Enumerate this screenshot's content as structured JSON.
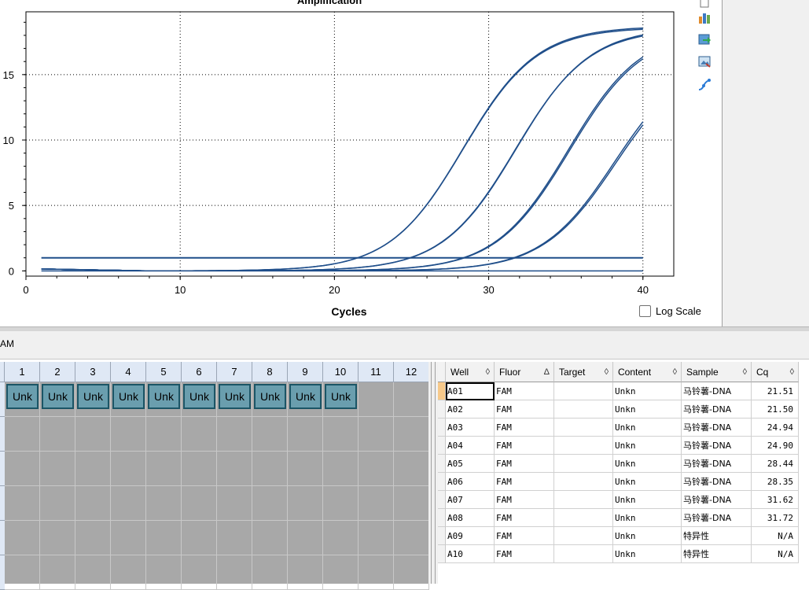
{
  "chart_data": {
    "type": "line",
    "title": "Amplification",
    "xlabel": "Cycles",
    "ylabel": "",
    "xlim": [
      0,
      42
    ],
    "ylim": [
      -0.4,
      19.8
    ],
    "xticks": [
      0,
      10,
      20,
      30,
      40
    ],
    "yticks": [
      0,
      5,
      10,
      15
    ],
    "grid": true,
    "line_color": "#1f4e8a",
    "threshold": 1.0,
    "cycle_range": [
      1,
      40
    ],
    "series": [
      {
        "cq": 21.51,
        "plateau": 18.6
      },
      {
        "cq": 21.5,
        "plateau": 18.7
      },
      {
        "cq": 24.94,
        "plateau": 18.6
      },
      {
        "cq": 24.9,
        "plateau": 18.5
      },
      {
        "cq": 28.44,
        "plateau": 18.4
      },
      {
        "cq": 28.35,
        "plateau": 18.5
      },
      {
        "cq": 31.62,
        "plateau": 16.7
      },
      {
        "cq": 31.72,
        "plateau": 16.5
      }
    ]
  },
  "log_scale_label": "Log Scale",
  "fluor_label": "AM",
  "plate": {
    "columns": [
      "1",
      "2",
      "3",
      "4",
      "5",
      "6",
      "7",
      "8",
      "9",
      "10",
      "11",
      "12"
    ],
    "filled_label": "Unk",
    "filled_count": 10,
    "rows": 6
  },
  "table": {
    "headers": [
      {
        "label": "Well",
        "sort": "◊"
      },
      {
        "label": "Fluor",
        "sort": "Δ"
      },
      {
        "label": "Target",
        "sort": "◊"
      },
      {
        "label": "Content",
        "sort": "◊"
      },
      {
        "label": "Sample",
        "sort": "◊"
      },
      {
        "label": "Cq",
        "sort": "◊"
      }
    ],
    "rows": [
      [
        "A01",
        "FAM",
        "",
        "Unkn",
        "马铃薯-DNA",
        "21.51"
      ],
      [
        "A02",
        "FAM",
        "",
        "Unkn",
        "马铃薯-DNA",
        "21.50"
      ],
      [
        "A03",
        "FAM",
        "",
        "Unkn",
        "马铃薯-DNA",
        "24.94"
      ],
      [
        "A04",
        "FAM",
        "",
        "Unkn",
        "马铃薯-DNA",
        "24.90"
      ],
      [
        "A05",
        "FAM",
        "",
        "Unkn",
        "马铃薯-DNA",
        "28.44"
      ],
      [
        "A06",
        "FAM",
        "",
        "Unkn",
        "马铃薯-DNA",
        "28.35"
      ],
      [
        "A07",
        "FAM",
        "",
        "Unkn",
        "马铃薯-DNA",
        "31.62"
      ],
      [
        "A08",
        "FAM",
        "",
        "Unkn",
        "马铃薯-DNA",
        "31.72"
      ],
      [
        "A09",
        "FAM",
        "",
        "Unkn",
        "特异性",
        "N/A"
      ],
      [
        "A10",
        "FAM",
        "",
        "Unkn",
        "特异性",
        "N/A"
      ]
    ]
  },
  "toolbar_icons": [
    "page-icon",
    "chart-bars-icon",
    "export-icon",
    "image-icon",
    "curve-icon"
  ]
}
